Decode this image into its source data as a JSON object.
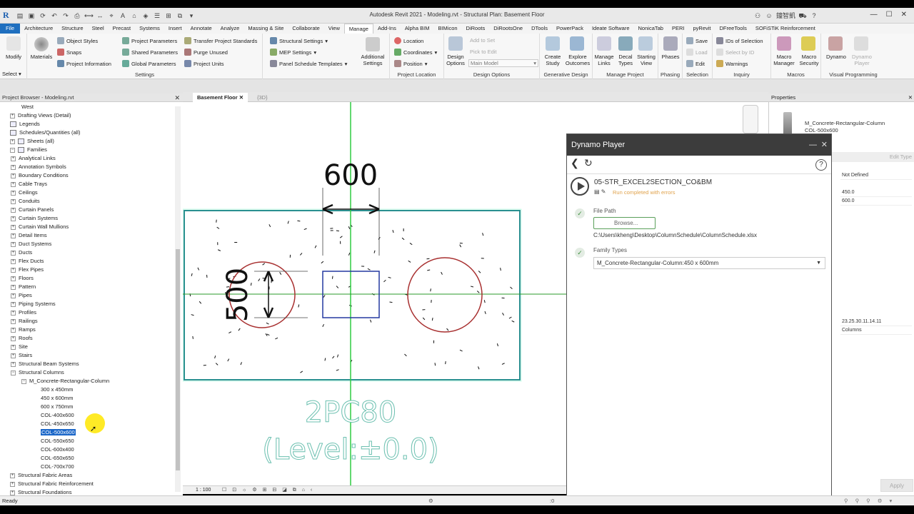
{
  "window": {
    "title": "Autodesk Revit 2021 - Modeling.rvt - Structural Plan: Basement Floor",
    "user": "鐘智凱"
  },
  "menu": [
    "File",
    "Architecture",
    "Structure",
    "Steel",
    "Precast",
    "Systems",
    "Insert",
    "Annotate",
    "Analyze",
    "Massing & Site",
    "Collaborate",
    "View",
    "Manage",
    "Add-Ins",
    "Alpha BIM",
    "BIMicon",
    "DiRoots",
    "DiRootsOne",
    "DTools",
    "PowerPack",
    "Ideate Software",
    "NonicaTab",
    "PERI",
    "pyRevit",
    "DFreeTools",
    "SOFiSTiK Reinforcement"
  ],
  "ribbon": {
    "modify": "Modify",
    "select": "Select",
    "materials": "Materials",
    "settings": {
      "object_styles": "Object  Styles",
      "snaps": "Snaps",
      "project_information": "Project  Information",
      "project_parameters": "Project  Parameters",
      "shared_parameters": "Shared  Parameters",
      "global_parameters": "Global  Parameters",
      "transfer_standards": "Transfer  Project Standards",
      "purge_unused": "Purge  Unused",
      "project_units": "Project  Units",
      "label": "Settings"
    },
    "structural_settings": "Structural  Settings",
    "mep_settings": "MEP  Settings",
    "panel_schedule_templates": "Panel Schedule  Templates",
    "additional_settings": "Additional Settings",
    "project_location": {
      "location": "Location",
      "coordinates": "Coordinates",
      "position": "Position",
      "label": "Project Location"
    },
    "design_options": {
      "design_options": "Design Options",
      "add_to_set": "Add to Set",
      "pick_to_edit": "Pick to Edit",
      "main_model": "Main Model",
      "label": "Design Options"
    },
    "generative_design": {
      "create_study": "Create Study",
      "explore_outcomes": "Explore Outcomes",
      "label": "Generative Design"
    },
    "manage_project": {
      "manage_links": "Manage Links",
      "decal_types": "Decal Types",
      "starting_view": "Starting View",
      "label": "Manage Project"
    },
    "phasing": {
      "phases": "Phases",
      "label": "Phasing"
    },
    "selection": {
      "save": "Save",
      "load": "Load",
      "edit": "Edit",
      "label": "Selection"
    },
    "inquiry": {
      "ids_of_selection": "IDs of  Selection",
      "select_by_id": "Select  by ID",
      "warnings": "Warnings",
      "label": "Inquiry"
    },
    "macros": {
      "macro_manager": "Macro Manager",
      "macro_security": "Macro Security",
      "label": "Macros"
    },
    "visual_programming": {
      "dynamo": "Dynamo",
      "dynamo_player": "Dynamo Player",
      "label": "Visual Programming"
    }
  },
  "project_browser": {
    "title": "Project Browser - Modeling.rvt",
    "items": [
      {
        "text": "West",
        "indent": 3,
        "exp": ""
      },
      {
        "text": "Drafting Views (Detail)",
        "indent": 1,
        "exp": "+"
      },
      {
        "text": "Legends",
        "indent": 1,
        "exp": "i"
      },
      {
        "text": "Schedules/Quantities (all)",
        "indent": 1,
        "exp": "i"
      },
      {
        "text": "Sheets (all)",
        "indent": 1,
        "exp": "+i"
      },
      {
        "text": "Families",
        "indent": 1,
        "exp": "-i"
      },
      {
        "text": "Analytical Links",
        "indent": 2,
        "exp": "+"
      },
      {
        "text": "Annotation Symbols",
        "indent": 2,
        "exp": "+"
      },
      {
        "text": "Boundary Conditions",
        "indent": 2,
        "exp": "+"
      },
      {
        "text": "Cable Trays",
        "indent": 2,
        "exp": "+"
      },
      {
        "text": "Ceilings",
        "indent": 2,
        "exp": "+"
      },
      {
        "text": "Conduits",
        "indent": 2,
        "exp": "+"
      },
      {
        "text": "Curtain Panels",
        "indent": 2,
        "exp": "+"
      },
      {
        "text": "Curtain Systems",
        "indent": 2,
        "exp": "+"
      },
      {
        "text": "Curtain Wall Mullions",
        "indent": 2,
        "exp": "+"
      },
      {
        "text": "Detail Items",
        "indent": 2,
        "exp": "+"
      },
      {
        "text": "Duct Systems",
        "indent": 2,
        "exp": "+"
      },
      {
        "text": "Ducts",
        "indent": 2,
        "exp": "+"
      },
      {
        "text": "Flex Ducts",
        "indent": 2,
        "exp": "+"
      },
      {
        "text": "Flex Pipes",
        "indent": 2,
        "exp": "+"
      },
      {
        "text": "Floors",
        "indent": 2,
        "exp": "+"
      },
      {
        "text": "Pattern",
        "indent": 2,
        "exp": "+"
      },
      {
        "text": "Pipes",
        "indent": 2,
        "exp": "+"
      },
      {
        "text": "Piping Systems",
        "indent": 2,
        "exp": "+"
      },
      {
        "text": "Profiles",
        "indent": 2,
        "exp": "+"
      },
      {
        "text": "Railings",
        "indent": 2,
        "exp": "+"
      },
      {
        "text": "Ramps",
        "indent": 2,
        "exp": "+"
      },
      {
        "text": "Roofs",
        "indent": 2,
        "exp": "+"
      },
      {
        "text": "Site",
        "indent": 2,
        "exp": "+"
      },
      {
        "text": "Stairs",
        "indent": 2,
        "exp": "+"
      },
      {
        "text": "Structural Beam Systems",
        "indent": 2,
        "exp": "+"
      },
      {
        "text": "Structural Columns",
        "indent": 2,
        "exp": "-"
      },
      {
        "text": "M_Concrete-Rectangular-Column",
        "indent": 3,
        "exp": "-"
      },
      {
        "text": "300 x 450mm",
        "indent": 4,
        "exp": ""
      },
      {
        "text": "450 x 600mm",
        "indent": 4,
        "exp": ""
      },
      {
        "text": "600 x 750mm",
        "indent": 4,
        "exp": ""
      },
      {
        "text": "COL-400x600",
        "indent": 4,
        "exp": ""
      },
      {
        "text": "COL-450x650",
        "indent": 4,
        "exp": ""
      },
      {
        "text": "COL-500x600",
        "indent": 4,
        "exp": "",
        "selected": true
      },
      {
        "text": "COL-550x650",
        "indent": 4,
        "exp": ""
      },
      {
        "text": "COL-600x400",
        "indent": 4,
        "exp": ""
      },
      {
        "text": "COL-650x650",
        "indent": 4,
        "exp": ""
      },
      {
        "text": "COL-700x700",
        "indent": 4,
        "exp": ""
      },
      {
        "text": "Structural Fabric Areas",
        "indent": 1,
        "exp": "+"
      },
      {
        "text": "Structural Fabric Reinforcement",
        "indent": 1,
        "exp": "+"
      },
      {
        "text": "Structural Foundations",
        "indent": 1,
        "exp": "+"
      }
    ]
  },
  "view_tabs": {
    "active": "Basement Floor",
    "other": "{3D}"
  },
  "drawing": {
    "dim_horizontal": "600",
    "dim_vertical": "500",
    "tag_line1": "2PC80",
    "tag_line2": "(Level:±0.0)"
  },
  "view_bar": {
    "scale": "1 : 100"
  },
  "properties": {
    "title": "Properties",
    "family": "M_Concrete-Rectangular-Column",
    "type": "COL-500x600",
    "edit_type": "Edit Type",
    "values": [
      "Not Defined",
      "450.0",
      "600.0",
      "23.25.30.11.14.11",
      "Columns"
    ],
    "apply": "Apply"
  },
  "dynamo_player": {
    "title": "Dynamo Player",
    "script": "05-STR_EXCEL2SECTION_CO&BM",
    "status": "Run completed with errors",
    "file_path_label": "File Path",
    "browse": "Browse...",
    "file_path": "C:\\Users\\kheng\\Desktop\\ColumnSchedule\\ColumnSchedule.xlsx",
    "family_types_label": "Family Types",
    "family_type_value": "M_Concrete-Rectangular-Column:450 x 600mm",
    "status_color": "#e0a24b"
  },
  "status_bar": {
    "text": "Ready"
  }
}
